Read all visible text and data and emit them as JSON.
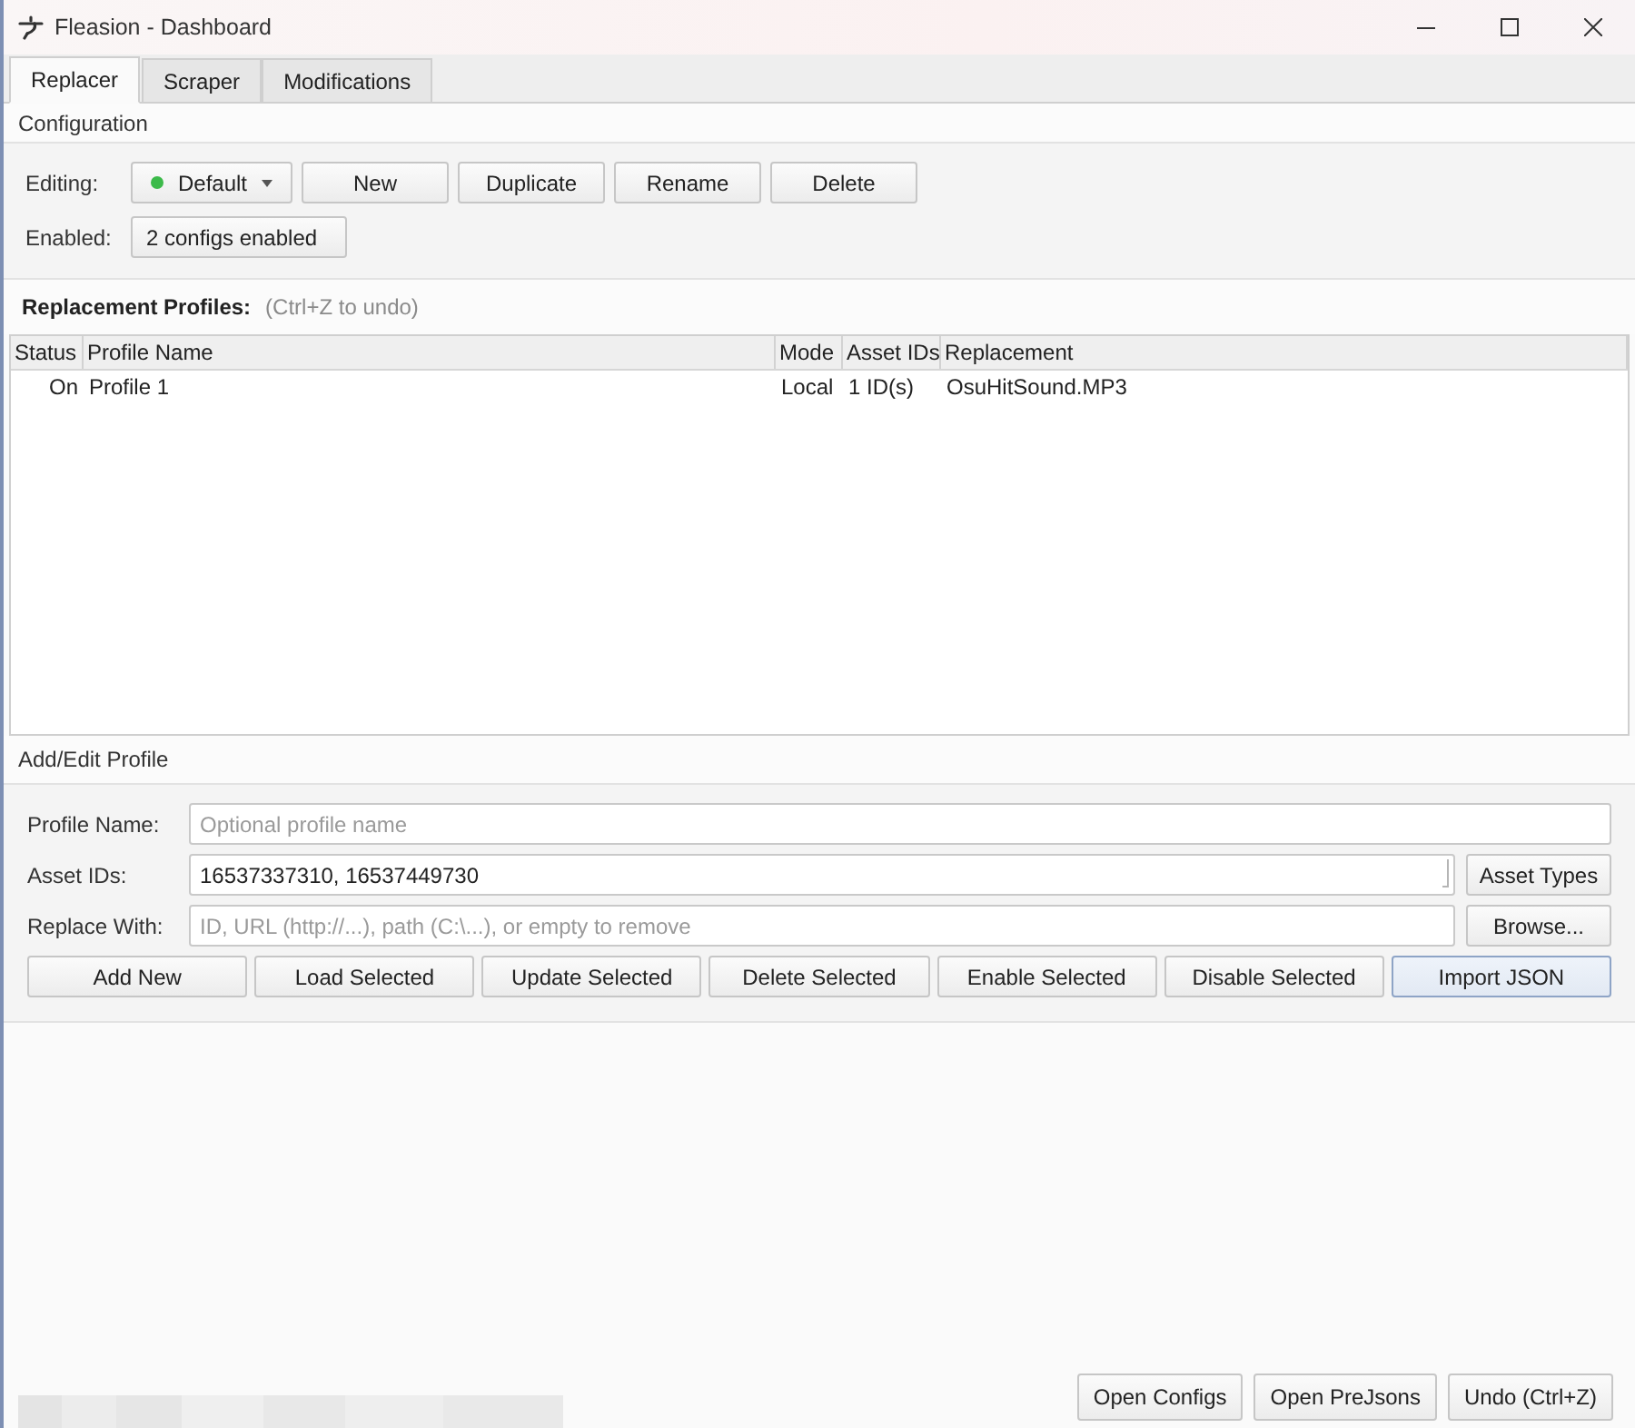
{
  "window": {
    "title": "Fleasion - Dashboard"
  },
  "tabs": [
    {
      "label": "Replacer",
      "selected": true
    },
    {
      "label": "Scraper",
      "selected": false
    },
    {
      "label": "Modifications",
      "selected": false
    }
  ],
  "configuration": {
    "title": "Configuration",
    "editing": {
      "label": "Editing:",
      "value": "Default",
      "color": "#3cba4a"
    },
    "buttons": [
      "New",
      "Duplicate",
      "Rename",
      "Delete"
    ],
    "enabled": {
      "label": "Enabled:",
      "value": "2 configs enabled"
    }
  },
  "profiles": {
    "title": "Replacement Profiles:",
    "hint": "(Ctrl+Z to undo)",
    "columns": [
      "Status",
      "Profile Name",
      "Mode",
      "Asset IDs",
      "Replacement"
    ],
    "rows": [
      {
        "selected": false,
        "cells": [
          "On",
          "Profile 1",
          "Local",
          "1 ID(s)",
          "OsuHitSound.MP3"
        ]
      }
    ]
  },
  "add_edit": {
    "title": "Add/Edit Profile",
    "fields": [
      {
        "label": "Profile Name:",
        "placeholder": "Optional profile name"
      },
      {
        "label": "Asset IDs:",
        "value": "16537337310, 16537449730",
        "button": "Asset Types"
      },
      {
        "label": "Replace With:",
        "placeholder": "ID, URL (http://...), path (C:\\...), or empty to remove",
        "button": "Browse..."
      }
    ],
    "buttons": [
      {
        "label": "Add New",
        "default": false
      },
      {
        "label": "Load Selected",
        "default": false
      },
      {
        "label": "Update Selected",
        "default": false
      },
      {
        "label": "Delete Selected",
        "default": false
      },
      {
        "label": "Enable Selected",
        "default": false
      },
      {
        "label": "Disable Selected",
        "default": false
      },
      {
        "label": "Import JSON",
        "default": true
      }
    ]
  },
  "footer": {
    "buttons": [
      "Open Configs",
      "Open PreJsons",
      "Undo (Ctrl+Z)"
    ]
  }
}
